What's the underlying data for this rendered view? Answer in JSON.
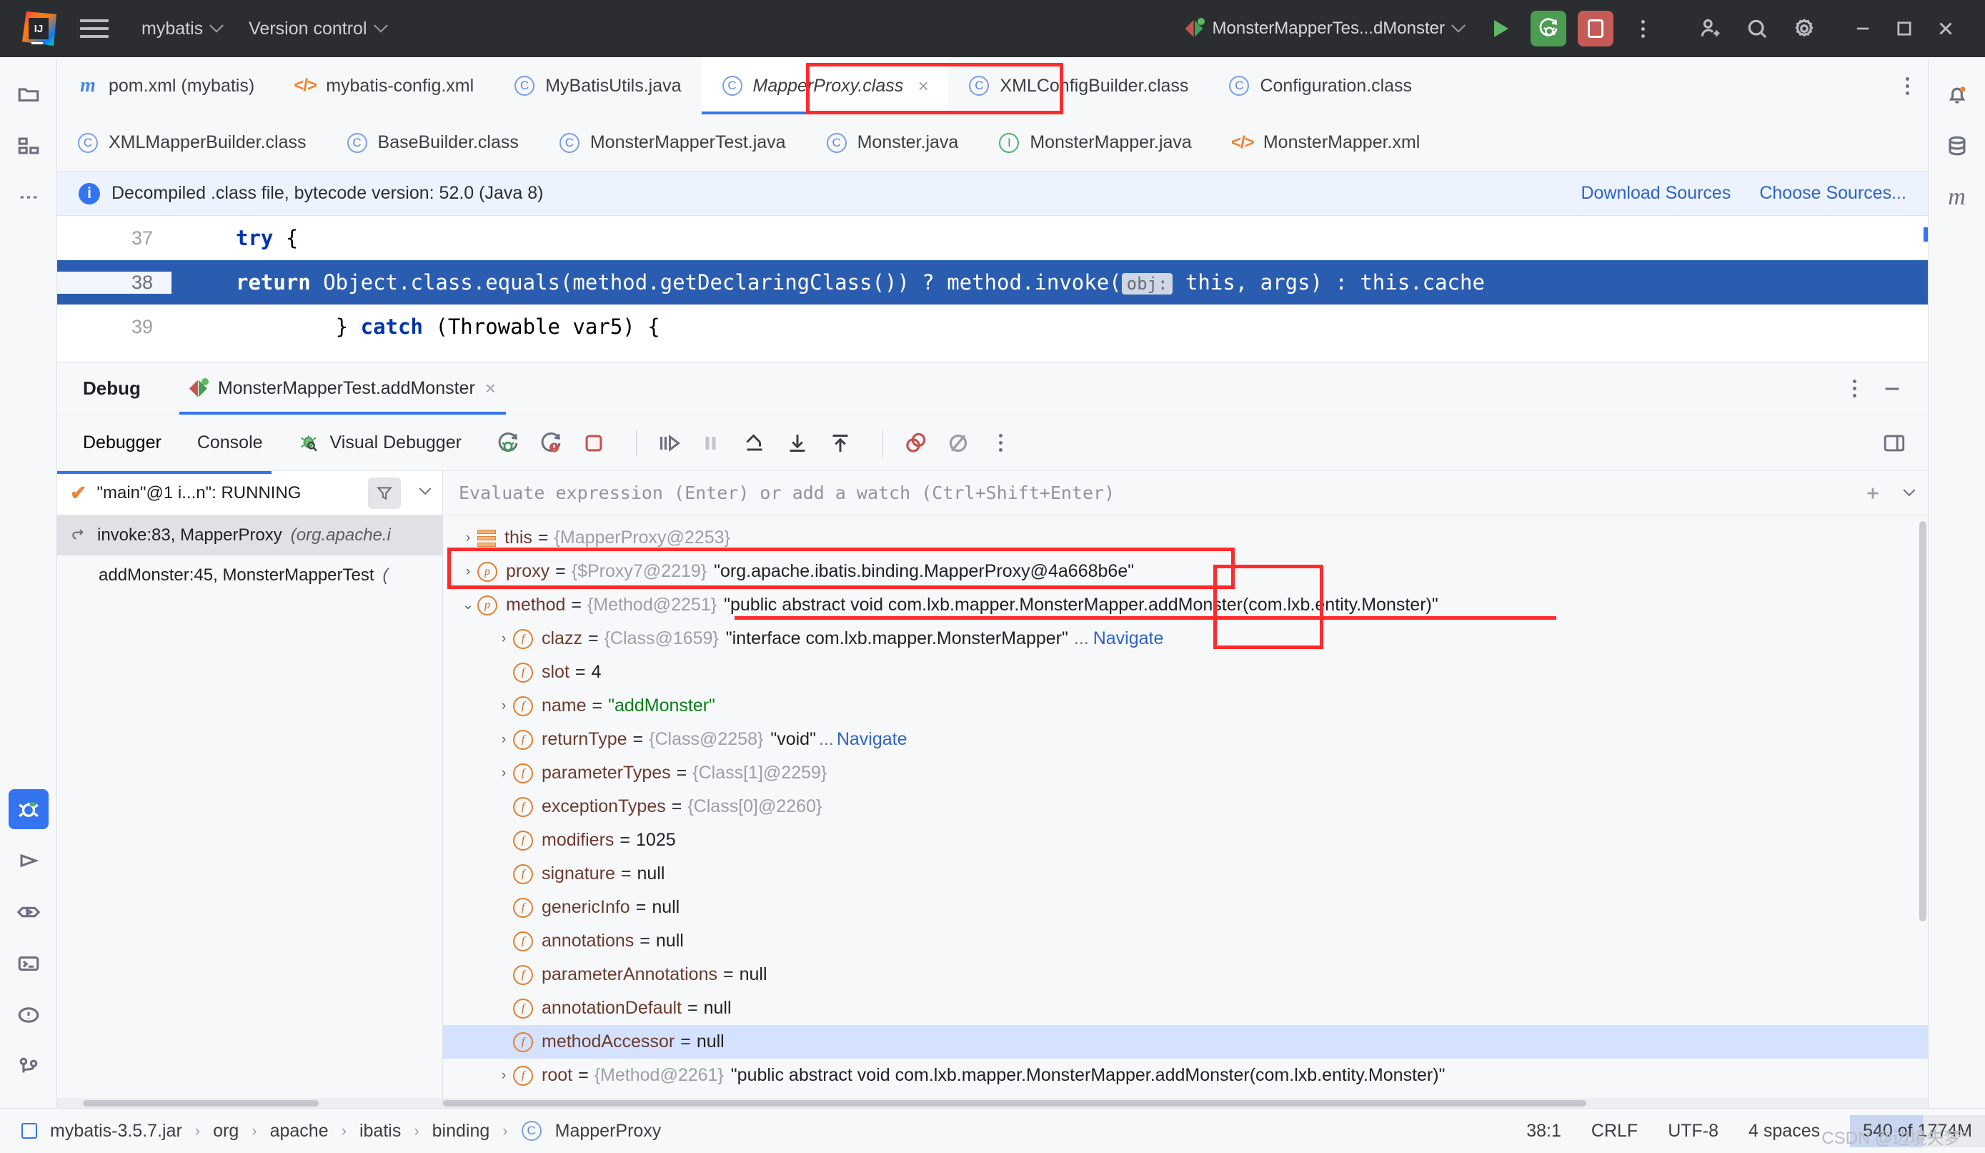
{
  "titlebar": {
    "project": "mybatis",
    "vcs": "Version control",
    "run_config": "MonsterMapperTes...dMonster",
    "icons": {
      "menu": "hamburger-icon",
      "run": "run-icon",
      "debug": "debug-icon",
      "stop": "stop-icon",
      "more": "more-vertical-icon",
      "add_user": "add-user-icon",
      "search": "search-icon",
      "settings": "gear-icon",
      "minimize": "minimize-icon",
      "maximize": "maximize-icon",
      "close": "close-icon"
    }
  },
  "left_rail": [
    {
      "name": "project-icon"
    },
    {
      "name": "structure-icon"
    },
    {
      "name": "more-tools-icon"
    }
  ],
  "left_rail_bottom": [
    {
      "name": "debug-tool-icon",
      "active": true
    },
    {
      "name": "run-tool-icon"
    },
    {
      "name": "services-icon"
    },
    {
      "name": "terminal-icon"
    },
    {
      "name": "problems-icon"
    },
    {
      "name": "git-branch-icon"
    }
  ],
  "right_rail": [
    {
      "name": "notifications-icon"
    },
    {
      "name": "database-icon"
    },
    {
      "name": "maven-icon",
      "label": "m"
    }
  ],
  "tabs_row1": [
    {
      "label": "pom.xml (mybatis)",
      "icon": "maven-file-icon",
      "icon_kind": "m",
      "selected": false
    },
    {
      "label": "mybatis-config.xml",
      "icon": "xml-file-icon",
      "icon_kind": "xml",
      "selected": false
    },
    {
      "label": "MyBatisUtils.java",
      "icon": "java-class-icon",
      "icon_kind": "c",
      "selected": false
    },
    {
      "label": "MapperProxy.class",
      "icon": "java-class-icon",
      "icon_kind": "c",
      "selected": true,
      "closable": true
    },
    {
      "label": "XMLConfigBuilder.class",
      "icon": "java-class-icon",
      "icon_kind": "c",
      "selected": false
    },
    {
      "label": "Configuration.class",
      "icon": "java-class-icon",
      "icon_kind": "c",
      "selected": false
    }
  ],
  "tabs_row2": [
    {
      "label": "XMLMapperBuilder.class",
      "icon": "java-class-icon",
      "icon_kind": "c"
    },
    {
      "label": "BaseBuilder.class",
      "icon": "java-class-icon",
      "icon_kind": "c"
    },
    {
      "label": "MonsterMapperTest.java",
      "icon": "java-class-icon",
      "icon_kind": "c"
    },
    {
      "label": "Monster.java",
      "icon": "java-class-icon",
      "icon_kind": "c"
    },
    {
      "label": "MonsterMapper.java",
      "icon": "java-interface-icon",
      "icon_kind": "i"
    },
    {
      "label": "MonsterMapper.xml",
      "icon": "xml-file-icon",
      "icon_kind": "xml"
    }
  ],
  "notification": {
    "text": "Decompiled .class file, bytecode version: 52.0 (Java 8)",
    "download_sources": "Download Sources",
    "choose_sources": "Choose Sources..."
  },
  "editor": {
    "lines": [
      {
        "number": "37",
        "indent": "        ",
        "keyword": "try",
        "rest": " {",
        "highlighted": false
      },
      {
        "number": "38",
        "indent": "          ",
        "keyword": "return",
        "rest": " Object.class.equals(method.getDeclaringClass()) ? method.invoke(",
        "hint": "obj:",
        "rest2": " this, args) : this.cache",
        "highlighted": true
      },
      {
        "number": "39",
        "indent": "        } ",
        "keyword": "catch",
        "rest": " (Throwable var5) {",
        "highlighted": false
      }
    ]
  },
  "debug": {
    "title": "Debug",
    "session": "MonsterMapperTest.addMonster",
    "tabs": [
      "Debugger",
      "Console"
    ],
    "visual_debugger": "Visual Debugger",
    "toolbar_icons": [
      "resume-program-icon",
      "resume-with-exception-icon",
      "stop-icon",
      "step-over-icon",
      "step-into-icon",
      "force-step-into-icon",
      "step-out-icon",
      "drop-frame-icon",
      "view-breakpoints-icon",
      "mute-breakpoints-icon",
      "more-vertical-icon"
    ],
    "thread": "\"main\"@1 i...n\": RUNNING",
    "frames": [
      {
        "label": "invoke:83, MapperProxy",
        "pkg": "(org.apache.i",
        "selected": true
      },
      {
        "label": "addMonster:45, MonsterMapperTest",
        "pkg": "(",
        "selected": false
      }
    ],
    "evaluate_placeholder": "Evaluate expression (Enter) or add a watch (Ctrl+Shift+Enter)"
  },
  "variables": [
    {
      "indent": 0,
      "arrow": "right",
      "icon": "this-icon",
      "name": "this",
      "eq": "=",
      "ref": "{MapperProxy@2253}",
      "value": "",
      "selected": false
    },
    {
      "indent": 0,
      "arrow": "right",
      "icon": "parameter-icon",
      "badge": "p",
      "name": "proxy",
      "eq": "=",
      "ref": "{$Proxy7@2219}",
      "value": "\"org.apache.ibatis.binding.MapperProxy@4a668b6e\"",
      "value_kind": "str",
      "selected": false
    },
    {
      "indent": 0,
      "arrow": "down",
      "icon": "parameter-icon",
      "badge": "p",
      "name": "method",
      "eq": "=",
      "ref": "{Method@2251}",
      "value": "\"public abstract void com.lxb.mapper.MonsterMapper.addMonster(com.lxb.entity.Monster)\"",
      "value_kind": "str",
      "selected": false
    },
    {
      "indent": 1,
      "arrow": "right",
      "icon": "field-icon",
      "badge": "f",
      "name": "clazz",
      "eq": "=",
      "ref": "{Class@1659}",
      "value": "\"interface com.lxb.mapper.MonsterMapper\"",
      "value_kind": "str",
      "dots": "...",
      "nav": "Navigate",
      "selected": false
    },
    {
      "indent": 1,
      "arrow": "none",
      "icon": "field-icon",
      "badge": "f",
      "name": "slot",
      "eq": "=",
      "ref": "",
      "value": "4",
      "value_kind": "num",
      "selected": false
    },
    {
      "indent": 1,
      "arrow": "right",
      "icon": "field-icon",
      "badge": "f",
      "name": "name",
      "eq": "=",
      "ref": "",
      "value": "\"addMonster\"",
      "value_kind": "green",
      "selected": false
    },
    {
      "indent": 1,
      "arrow": "right",
      "icon": "field-icon",
      "badge": "f",
      "name": "returnType",
      "eq": "=",
      "ref": "{Class@2258}",
      "value": "\"void\"",
      "value_kind": "str",
      "dots": "...",
      "nav": "Navigate",
      "selected": false
    },
    {
      "indent": 1,
      "arrow": "right",
      "icon": "field-icon",
      "badge": "f",
      "name": "parameterTypes",
      "eq": "=",
      "ref": "{Class[1]@2259}",
      "value": "",
      "selected": false
    },
    {
      "indent": 1,
      "arrow": "none",
      "icon": "field-icon",
      "badge": "f",
      "name": "exceptionTypes",
      "eq": "=",
      "ref": "{Class[0]@2260}",
      "value": "",
      "selected": false
    },
    {
      "indent": 1,
      "arrow": "none",
      "icon": "field-icon",
      "badge": "f",
      "name": "modifiers",
      "eq": "=",
      "ref": "",
      "value": "1025",
      "value_kind": "num",
      "selected": false
    },
    {
      "indent": 1,
      "arrow": "none",
      "icon": "field-icon",
      "badge": "f",
      "name": "signature",
      "eq": "=",
      "ref": "",
      "value": "null",
      "value_kind": "null",
      "selected": false
    },
    {
      "indent": 1,
      "arrow": "none",
      "icon": "field-icon",
      "badge": "f",
      "name": "genericInfo",
      "eq": "=",
      "ref": "",
      "value": "null",
      "value_kind": "null",
      "selected": false
    },
    {
      "indent": 1,
      "arrow": "none",
      "icon": "field-icon",
      "badge": "f",
      "name": "annotations",
      "eq": "=",
      "ref": "",
      "value": "null",
      "value_kind": "null",
      "selected": false
    },
    {
      "indent": 1,
      "arrow": "none",
      "icon": "field-icon",
      "badge": "f",
      "name": "parameterAnnotations",
      "eq": "=",
      "ref": "",
      "value": "null",
      "value_kind": "null",
      "selected": false
    },
    {
      "indent": 1,
      "arrow": "none",
      "icon": "field-icon",
      "badge": "f",
      "name": "annotationDefault",
      "eq": "=",
      "ref": "",
      "value": "null",
      "value_kind": "null",
      "selected": false
    },
    {
      "indent": 1,
      "arrow": "none",
      "icon": "field-icon",
      "badge": "f",
      "name": "methodAccessor",
      "eq": "=",
      "ref": "",
      "value": "null",
      "value_kind": "null",
      "selected": true
    },
    {
      "indent": 1,
      "arrow": "right",
      "icon": "field-icon",
      "badge": "f",
      "name": "root",
      "eq": "=",
      "ref": "{Method@2261}",
      "value": "\"public abstract void com.lxb.mapper.MonsterMapper.addMonster(com.lxb.entity.Monster)\"",
      "value_kind": "str",
      "selected": false
    }
  ],
  "statusbar": {
    "breadcrumb": [
      "mybatis-3.5.7.jar",
      "org",
      "apache",
      "ibatis",
      "binding",
      "MapperProxy"
    ],
    "position": "38:1",
    "line_sep": "CRLF",
    "encoding": "UTF-8",
    "indent": "4 spaces",
    "memory": "540 of 1774M",
    "watermark": "CSDN @边境失梦°"
  },
  "colors": {
    "accent": "#3574f0",
    "annotation": "#ff2b2b",
    "titlebar_bg": "#2b2d30",
    "debug_green": "#4c9c52",
    "stop_red": "#c45b57"
  }
}
